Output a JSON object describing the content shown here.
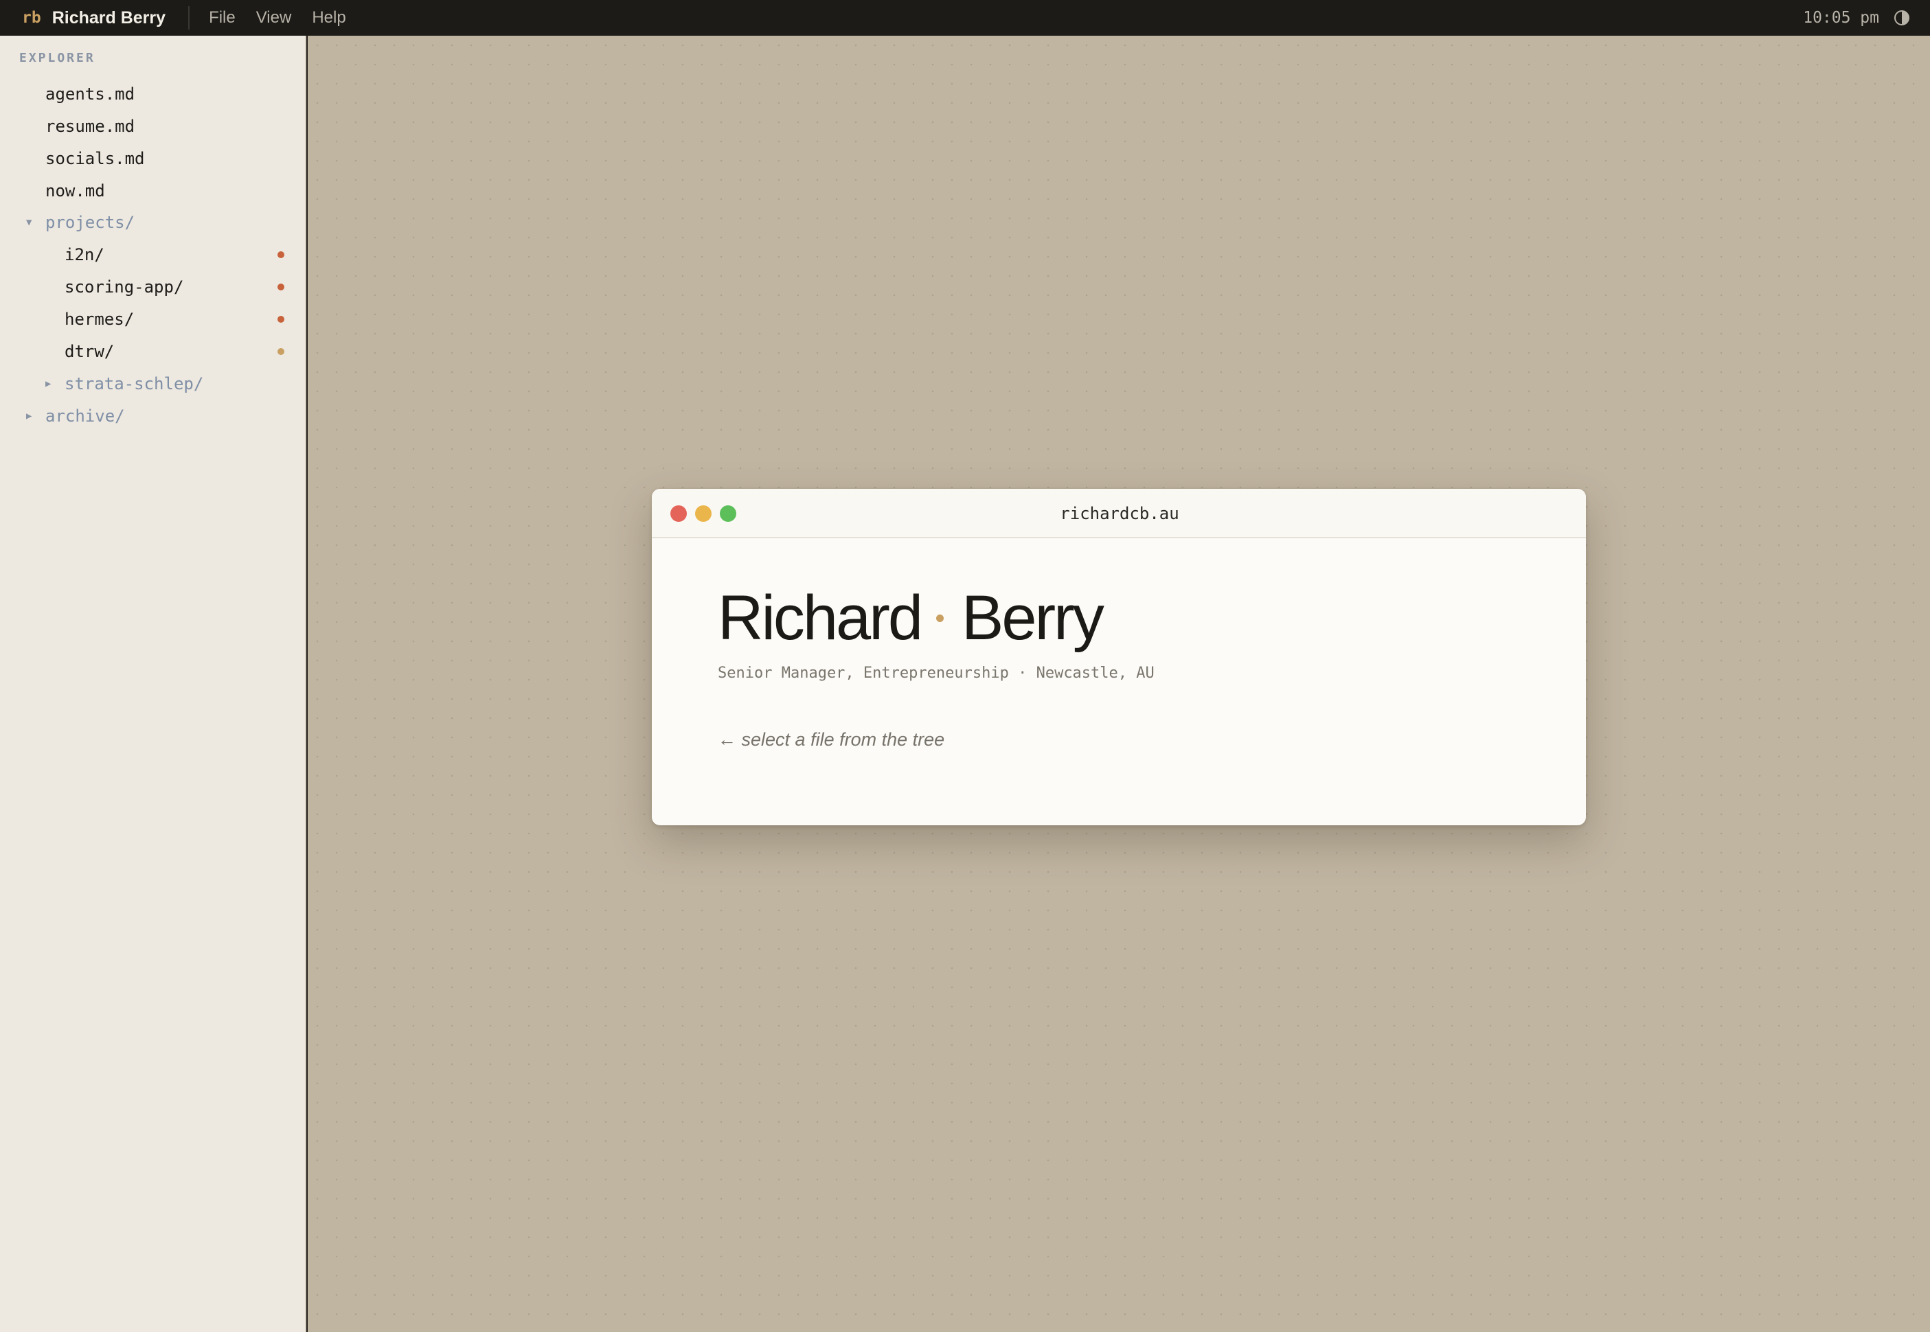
{
  "menubar": {
    "brand_mark": "rb",
    "brand_name": "Richard Berry",
    "menus": [
      "File",
      "View",
      "Help"
    ],
    "clock": "10:05 pm",
    "theme_icon": "half-circle-icon"
  },
  "sidebar": {
    "title": "EXPLORER",
    "items": [
      {
        "label": "agents.md",
        "type": "file"
      },
      {
        "label": "resume.md",
        "type": "file"
      },
      {
        "label": "socials.md",
        "type": "file"
      },
      {
        "label": "now.md",
        "type": "file"
      },
      {
        "label": "projects/",
        "type": "folder",
        "expanded": true
      },
      {
        "label": "i2n/",
        "type": "project",
        "dot_color": "#c8623a"
      },
      {
        "label": "scoring-app/",
        "type": "project",
        "dot_color": "#c8623a"
      },
      {
        "label": "hermes/",
        "type": "project",
        "dot_color": "#c8623a"
      },
      {
        "label": "dtrw/",
        "type": "project",
        "dot_color": "#c9a062"
      },
      {
        "label": "strata-schlep/",
        "type": "folder",
        "expanded": false
      },
      {
        "label": "archive/",
        "type": "folder",
        "expanded": false
      }
    ]
  },
  "window": {
    "title": "richardcb.au",
    "first_name": "Richard",
    "last_name": "Berry",
    "subtitle": "Senior Manager, Entrepreneurship · Newcastle, AU",
    "hint": "select a file from the tree",
    "hint_icon": "arrow-left-icon"
  },
  "colors": {
    "accent": "#c9a062",
    "status_active": "#c8623a",
    "desktop": "#c0b5a1",
    "sidebar": "#ede8e0"
  }
}
